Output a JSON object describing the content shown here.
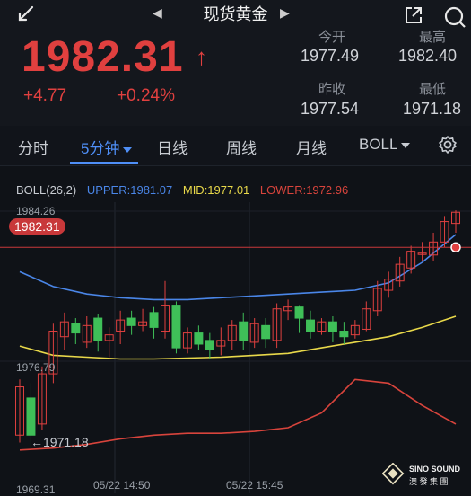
{
  "header": {
    "title": "现货黄金",
    "back_icon": "back-arrow-icon",
    "share_icon": "share-icon",
    "search_icon": "search-icon"
  },
  "quote": {
    "price": "1982.31",
    "direction_icon": "up-arrow-icon",
    "change": "+4.77",
    "change_pct": "+0.24%",
    "color": "#e0403f"
  },
  "stats": {
    "open_label": "今开",
    "open": "1977.49",
    "high_label": "最高",
    "high": "1982.40",
    "prev_close_label": "昨收",
    "prev_close": "1977.54",
    "low_label": "最低",
    "low": "1971.18"
  },
  "tabs": [
    {
      "label": "分时"
    },
    {
      "label": "5分钟",
      "active": true
    },
    {
      "label": "日线"
    },
    {
      "label": "周线"
    },
    {
      "label": "月线"
    },
    {
      "label": "BOLL"
    }
  ],
  "indicator": {
    "name": "BOLL(26,2)",
    "upper": "UPPER:1981.07",
    "mid": "MID:1977.01",
    "lower": "LOWER:1972.96",
    "upper_color": "#4a86e8",
    "mid_color": "#e8d84a",
    "lower_color": "#d8443c"
  },
  "chart": {
    "y_top": "1984.26",
    "y_mid": "1976.79",
    "y_bottom": "1969.31",
    "current_tag": "1982.31",
    "low_marker": "←1971.18",
    "x_labels": [
      "05/22 14:50",
      "05/22 15:45"
    ]
  },
  "brand": {
    "name": "SINO SOUND",
    "sub": "澳 發 集 團"
  },
  "chart_data": {
    "type": "candlestick",
    "ylim": [
      1969.31,
      1984.26
    ],
    "x_labels": [
      "05/22 14:50",
      "05/22 15:45"
    ],
    "candles": [
      [
        1972.2,
        1974.8,
        1971.8,
        1975.2
      ],
      [
        1974.2,
        1972.2,
        1971.5,
        1975.0
      ],
      [
        1972.8,
        1975.5,
        1972.5,
        1975.9
      ],
      [
        1975.5,
        1977.8,
        1975.0,
        1978.2
      ],
      [
        1977.5,
        1978.3,
        1976.8,
        1978.8
      ],
      [
        1978.2,
        1977.7,
        1977.1,
        1978.5
      ],
      [
        1977.2,
        1978.1,
        1976.9,
        1978.6
      ],
      [
        1978.5,
        1977.3,
        1976.7,
        1978.7
      ],
      [
        1977.3,
        1977.6,
        1976.4,
        1978.0
      ],
      [
        1977.8,
        1978.4,
        1977.1,
        1978.9
      ],
      [
        1978.5,
        1978.1,
        1977.6,
        1978.9
      ],
      [
        1978.1,
        1978.3,
        1977.8,
        1979.0
      ],
      [
        1978.8,
        1978.0,
        1977.4,
        1979.1
      ],
      [
        1977.8,
        1979.2,
        1977.4,
        1980.5
      ],
      [
        1979.2,
        1976.9,
        1976.6,
        1979.4
      ],
      [
        1976.9,
        1977.7,
        1976.6,
        1978.0
      ],
      [
        1977.7,
        1977.1,
        1976.8,
        1978.1
      ],
      [
        1977.3,
        1976.8,
        1976.3,
        1977.7
      ],
      [
        1977.0,
        1977.3,
        1976.5,
        1978.0
      ],
      [
        1977.3,
        1978.1,
        1976.8,
        1978.4
      ],
      [
        1978.3,
        1977.3,
        1976.8,
        1978.8
      ],
      [
        1977.2,
        1978.2,
        1976.9,
        1978.5
      ],
      [
        1978.1,
        1977.4,
        1976.9,
        1978.5
      ],
      [
        1977.3,
        1979.0,
        1976.9,
        1979.3
      ],
      [
        1978.9,
        1979.1,
        1978.4,
        1979.5
      ],
      [
        1979.1,
        1978.5,
        1977.7,
        1979.2
      ],
      [
        1978.4,
        1977.8,
        1977.4,
        1978.9
      ],
      [
        1977.8,
        1978.3,
        1977.6,
        1978.5
      ],
      [
        1978.3,
        1977.8,
        1977.2,
        1978.6
      ],
      [
        1977.8,
        1977.5,
        1977.1,
        1978.3
      ],
      [
        1977.6,
        1978.1,
        1977.4,
        1978.4
      ],
      [
        1977.9,
        1979.0,
        1977.8,
        1979.4
      ],
      [
        1978.9,
        1980.1,
        1978.6,
        1980.5
      ],
      [
        1980.0,
        1980.6,
        1979.6,
        1981.0
      ],
      [
        1980.5,
        1981.4,
        1980.2,
        1981.8
      ],
      [
        1981.2,
        1982.1,
        1980.9,
        1982.4
      ],
      [
        1982.0,
        1982.0,
        1981.6,
        1982.6
      ],
      [
        1981.9,
        1982.6,
        1981.6,
        1983.1
      ],
      [
        1982.6,
        1983.7,
        1982.3,
        1984.0
      ],
      [
        1983.6,
        1984.2,
        1983.1,
        1984.3
      ]
    ],
    "series": [
      {
        "name": "UPPER",
        "values": [
          1981.0,
          1980.2,
          1979.8,
          1979.6,
          1979.5,
          1979.5,
          1979.6,
          1979.7,
          1979.8,
          1979.9,
          1980.0,
          1980.4,
          1981.5,
          1983.0
        ]
      },
      {
        "name": "MID",
        "values": [
          1977.0,
          1976.5,
          1976.4,
          1976.3,
          1976.3,
          1976.35,
          1976.4,
          1976.5,
          1976.6,
          1976.9,
          1977.2,
          1977.5,
          1978.0,
          1978.6
        ]
      },
      {
        "name": "LOWER",
        "values": [
          1971.4,
          1971.5,
          1971.7,
          1972.0,
          1972.2,
          1972.3,
          1972.3,
          1972.4,
          1972.6,
          1973.4,
          1975.2,
          1975.0,
          1973.8,
          1972.8
        ]
      }
    ]
  }
}
